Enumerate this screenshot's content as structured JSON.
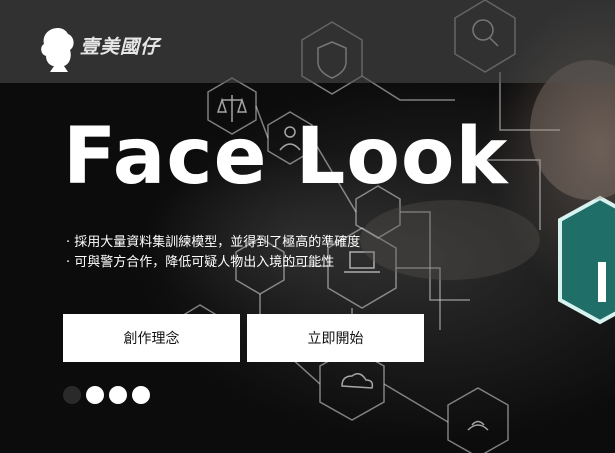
{
  "header": {
    "logo_text": "壹美國仔"
  },
  "hero": {
    "title": "Face Look",
    "bullets": [
      "· 採用大量資料集訓練模型，並得到了極高的準確度",
      "· 可與警方合作，降低可疑人物出入境的可能性"
    ],
    "buttons": {
      "concept": "創作理念",
      "start": "立即開始"
    }
  },
  "carousel": {
    "slide_count": 4,
    "active_index": 0
  },
  "colors": {
    "header_bg": "#505050",
    "button_bg": "#ffffff",
    "accent_teal": "#3fb6a8"
  }
}
